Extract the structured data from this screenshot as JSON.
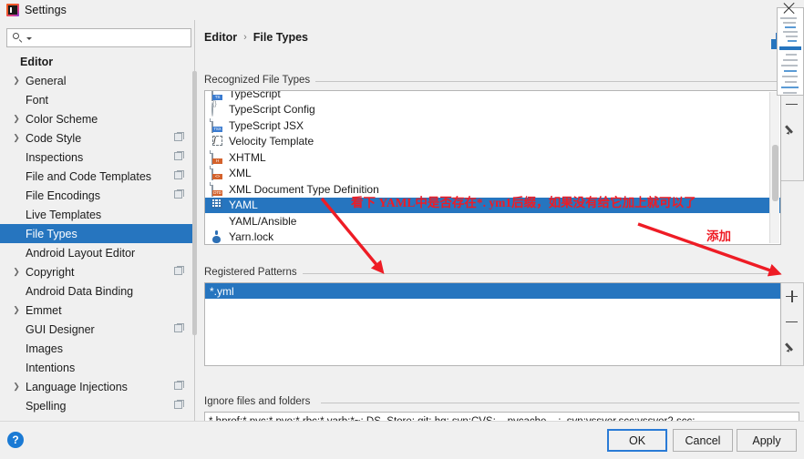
{
  "window": {
    "title": "Settings",
    "icon": "intellij-logo-icon"
  },
  "search": {
    "value": "",
    "placeholder": "",
    "icon": "search-icon"
  },
  "sidebar": {
    "root_label": "Editor",
    "items": [
      {
        "label": "General",
        "expandable": true,
        "badge": false
      },
      {
        "label": "Font",
        "expandable": false,
        "badge": false
      },
      {
        "label": "Color Scheme",
        "expandable": true,
        "badge": false
      },
      {
        "label": "Code Style",
        "expandable": true,
        "badge": true
      },
      {
        "label": "Inspections",
        "expandable": false,
        "badge": true
      },
      {
        "label": "File and Code Templates",
        "expandable": false,
        "badge": true
      },
      {
        "label": "File Encodings",
        "expandable": false,
        "badge": true
      },
      {
        "label": "Live Templates",
        "expandable": false,
        "badge": false
      },
      {
        "label": "File Types",
        "expandable": false,
        "badge": false,
        "selected": true
      },
      {
        "label": "Android Layout Editor",
        "expandable": false,
        "badge": false
      },
      {
        "label": "Copyright",
        "expandable": true,
        "badge": true
      },
      {
        "label": "Android Data Binding",
        "expandable": false,
        "badge": false
      },
      {
        "label": "Emmet",
        "expandable": true,
        "badge": false
      },
      {
        "label": "GUI Designer",
        "expandable": false,
        "badge": true
      },
      {
        "label": "Images",
        "expandable": false,
        "badge": false
      },
      {
        "label": "Intentions",
        "expandable": false,
        "badge": false
      },
      {
        "label": "Language Injections",
        "expandable": true,
        "badge": true
      },
      {
        "label": "Spelling",
        "expandable": false,
        "badge": true
      }
    ]
  },
  "breadcrumb": {
    "parent": "Editor",
    "separator": "›",
    "current": "File Types"
  },
  "reset_link": "Re",
  "recognized": {
    "group_label": "Recognized File Types",
    "items": [
      {
        "label": "TypeScript",
        "icon": "typescript-file-icon",
        "tag": "TS"
      },
      {
        "label": "TypeScript Config",
        "icon": "typescript-config-icon",
        "tag": ""
      },
      {
        "label": "TypeScript JSX",
        "icon": "typescript-jsx-icon",
        "tag": "TSX"
      },
      {
        "label": "Velocity Template",
        "icon": "velocity-template-icon",
        "tag": ""
      },
      {
        "label": "XHTML",
        "icon": "xhtml-file-icon",
        "tag": "H"
      },
      {
        "label": "XML",
        "icon": "xml-file-icon",
        "tag": "<>"
      },
      {
        "label": "XML Document Type Definition",
        "icon": "dtd-file-icon",
        "tag": "DTD"
      },
      {
        "label": "YAML",
        "icon": "yaml-file-icon",
        "tag": "",
        "selected": true
      },
      {
        "label": "YAML/Ansible",
        "icon": "ansible-icon",
        "tag": ""
      },
      {
        "label": "Yarn.lock",
        "icon": "yarn-icon",
        "tag": ""
      }
    ],
    "toolbar": [
      {
        "name": "remove-file-type-button",
        "icon": "minus-icon"
      },
      {
        "name": "edit-file-type-button",
        "icon": "pencil-icon"
      }
    ]
  },
  "patterns": {
    "group_label": "Registered Patterns",
    "items": [
      {
        "label": "*.yml",
        "selected": true
      }
    ],
    "toolbar": [
      {
        "name": "add-pattern-button",
        "icon": "plus-icon"
      },
      {
        "name": "remove-pattern-button",
        "icon": "minus-icon"
      },
      {
        "name": "edit-pattern-button",
        "icon": "pencil-icon"
      }
    ]
  },
  "ignore": {
    "group_label": "Ignore files and folders",
    "value": "*.hprof;*.pyc;*.pyo;*.rbc;*.yarb;*~;.DS_Store;.git;.hg;.svn;CVS;__pycache__;_svn;vssver.scc;vssver2.scc;",
    "placeholder": ""
  },
  "footer": {
    "help_icon": "help-question-icon",
    "buttons": [
      {
        "label": "OK",
        "default": true
      },
      {
        "label": "Cancel",
        "default": false
      },
      {
        "label": "Apply",
        "default": false
      }
    ]
  },
  "annotations": {
    "note_main": "看下 YAML中是否存在*. ym1后缀，如果没有给它加上就可以了",
    "note_add": "添加",
    "color": "#ee1c25"
  },
  "overlay": {
    "close_icon": "close-icon"
  }
}
